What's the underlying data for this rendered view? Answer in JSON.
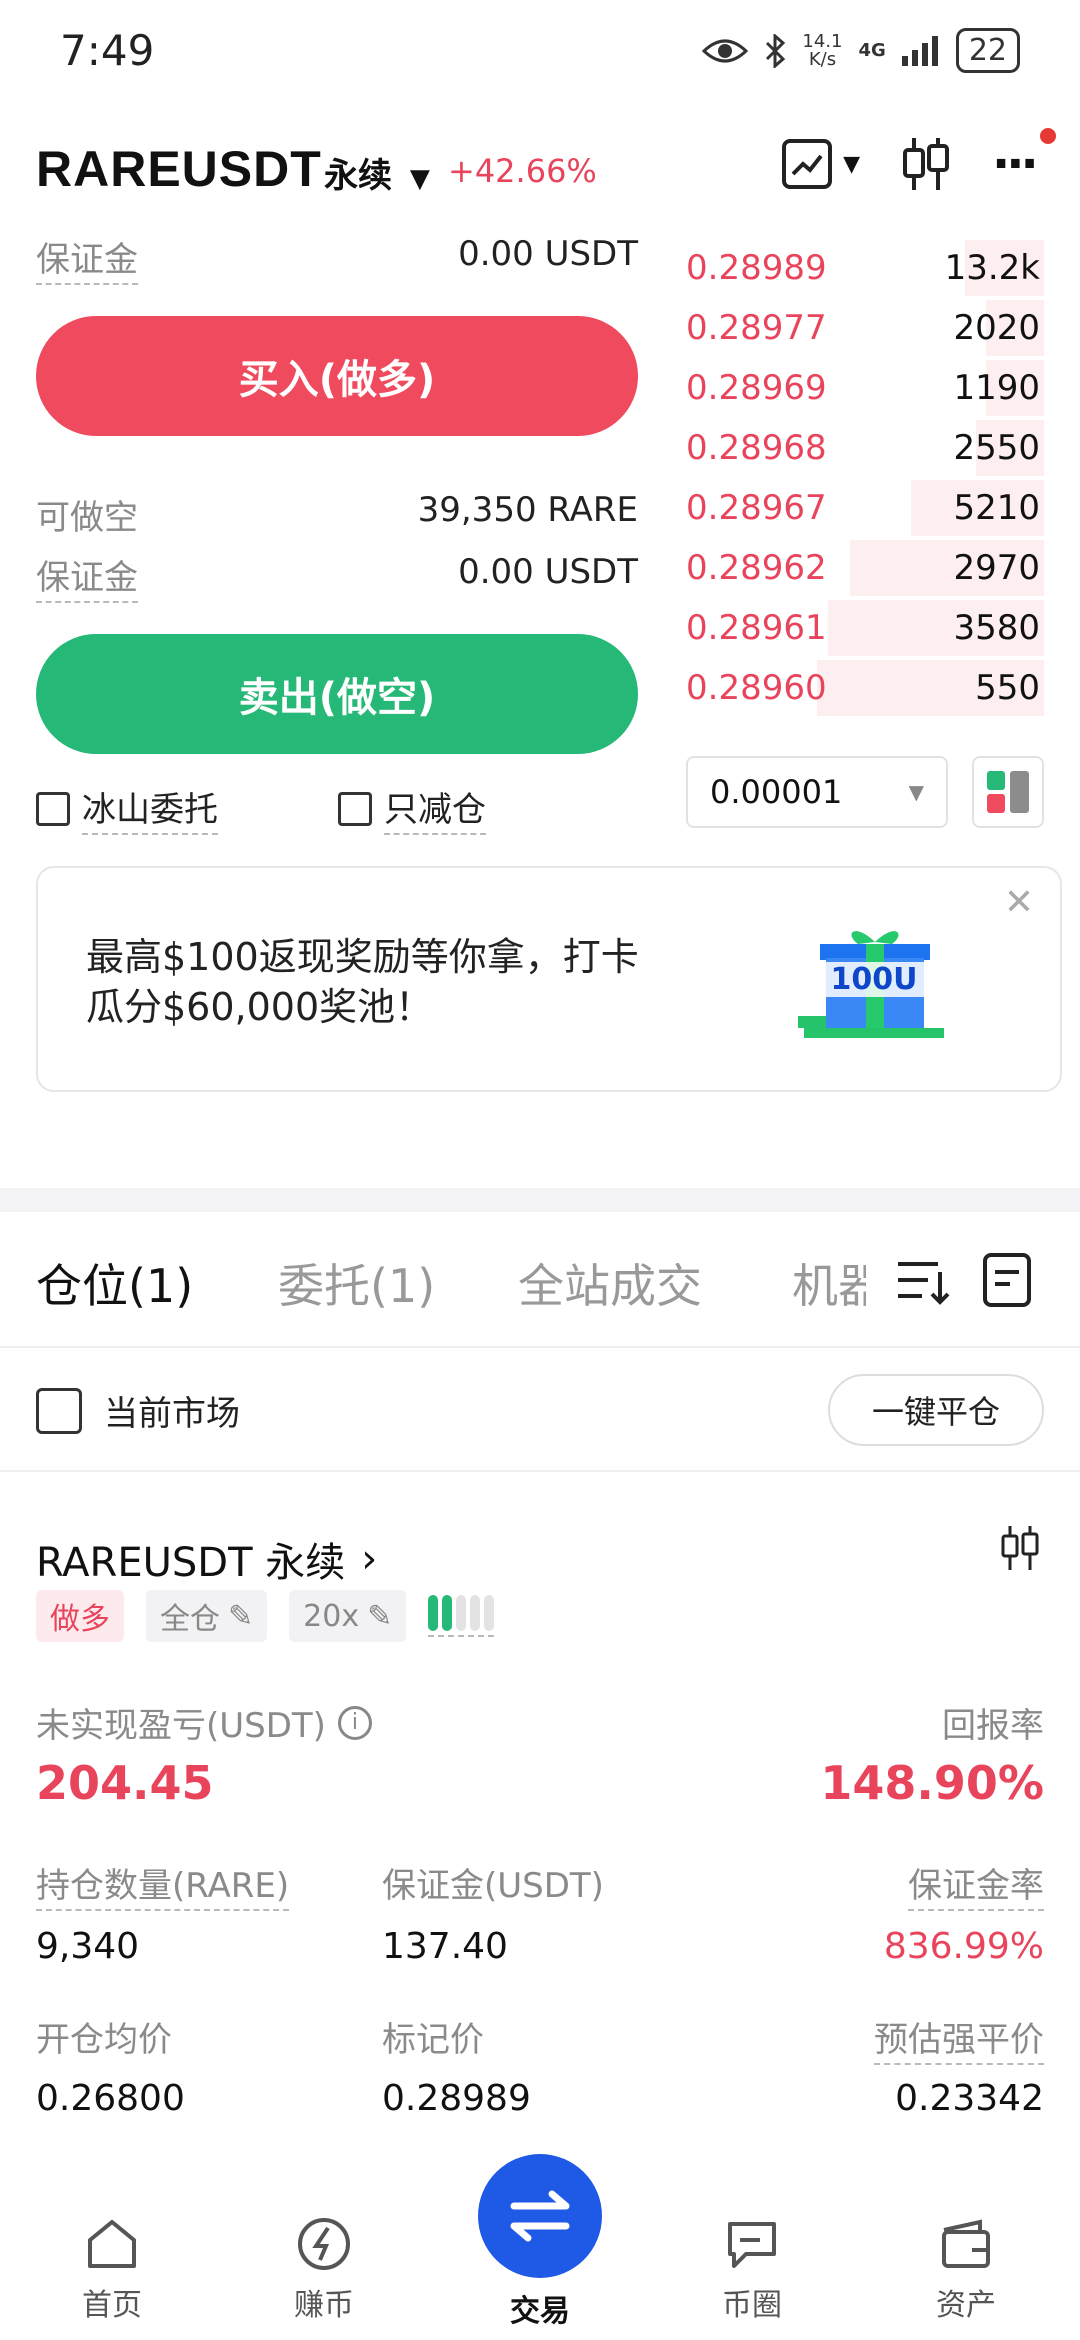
{
  "status_bar": {
    "time": "7:49",
    "net_speed_top": "14.1",
    "net_speed_bottom": "K/s",
    "network": "4G",
    "battery": "22"
  },
  "header": {
    "symbol": "RAREUSDT",
    "contract_type": "永续",
    "change": "+42.66%"
  },
  "long_panel": {
    "margin_label": "保证金",
    "margin_value": "0.00 USDT",
    "buy_label": "买入(做多)"
  },
  "short_panel": {
    "available_label": "可做空",
    "available_value": "39,350 RARE",
    "margin_label": "保证金",
    "margin_value": "0.00 USDT",
    "sell_label": "卖出(做空)"
  },
  "options": {
    "iceberg_label": "冰山委托",
    "reduce_only_label": "只减仓"
  },
  "order_book": {
    "asks": [
      {
        "price": "0.28989",
        "qty": "13.2k",
        "depth": 0.22
      },
      {
        "price": "0.28977",
        "qty": "2020",
        "depth": 0.16
      },
      {
        "price": "0.28969",
        "qty": "1190",
        "depth": 0.16
      },
      {
        "price": "0.28968",
        "qty": "2550",
        "depth": 0.19
      },
      {
        "price": "0.28967",
        "qty": "5210",
        "depth": 0.37
      },
      {
        "price": "0.28962",
        "qty": "2970",
        "depth": 0.54
      },
      {
        "price": "0.28961",
        "qty": "3580",
        "depth": 0.6
      },
      {
        "price": "0.28960",
        "qty": "550",
        "depth": 0.63
      }
    ],
    "precision": "0.00001"
  },
  "banner": {
    "line1": "最高$100返现奖励等你拿，打卡",
    "line2": "瓜分$60,000奖池！",
    "gift_text": "100U"
  },
  "tabs": [
    {
      "label": "仓位(1)",
      "active": true
    },
    {
      "label": "委托(1)",
      "active": false
    },
    {
      "label": "全站成交",
      "active": false
    },
    {
      "label": "机器",
      "active": false
    }
  ],
  "filter": {
    "current_market_label": "当前市场",
    "close_all_label": "一键平仓"
  },
  "position": {
    "symbol": "RAREUSDT 永续",
    "side": "做多",
    "margin_mode": "全仓",
    "leverage": "20x",
    "risk_level": 2,
    "unrealized_pnl_label": "未实现盈亏(USDT)",
    "unrealized_pnl": "204.45",
    "roe_label": "回报率",
    "roe": "148.90%",
    "size_label": "持仓数量(RARE)",
    "size": "9,340",
    "margin_label": "保证金(USDT)",
    "margin": "137.40",
    "margin_ratio_label": "保证金率",
    "margin_ratio": "836.99%",
    "entry_label": "开仓均价",
    "entry": "0.26800",
    "mark_label": "标记价",
    "mark": "0.28989",
    "liq_label": "预估强平价",
    "liq": "0.23342"
  },
  "nav": [
    {
      "label": "首页",
      "icon": "home-icon"
    },
    {
      "label": "赚币",
      "icon": "earn-icon"
    },
    {
      "label": "交易",
      "icon": "trade-swap-icon"
    },
    {
      "label": "币圈",
      "icon": "chat-icon"
    },
    {
      "label": "资产",
      "icon": "wallet-icon"
    }
  ],
  "colors": {
    "red": "#e8455c",
    "green": "#25b876",
    "blue": "#1f5ae6"
  }
}
